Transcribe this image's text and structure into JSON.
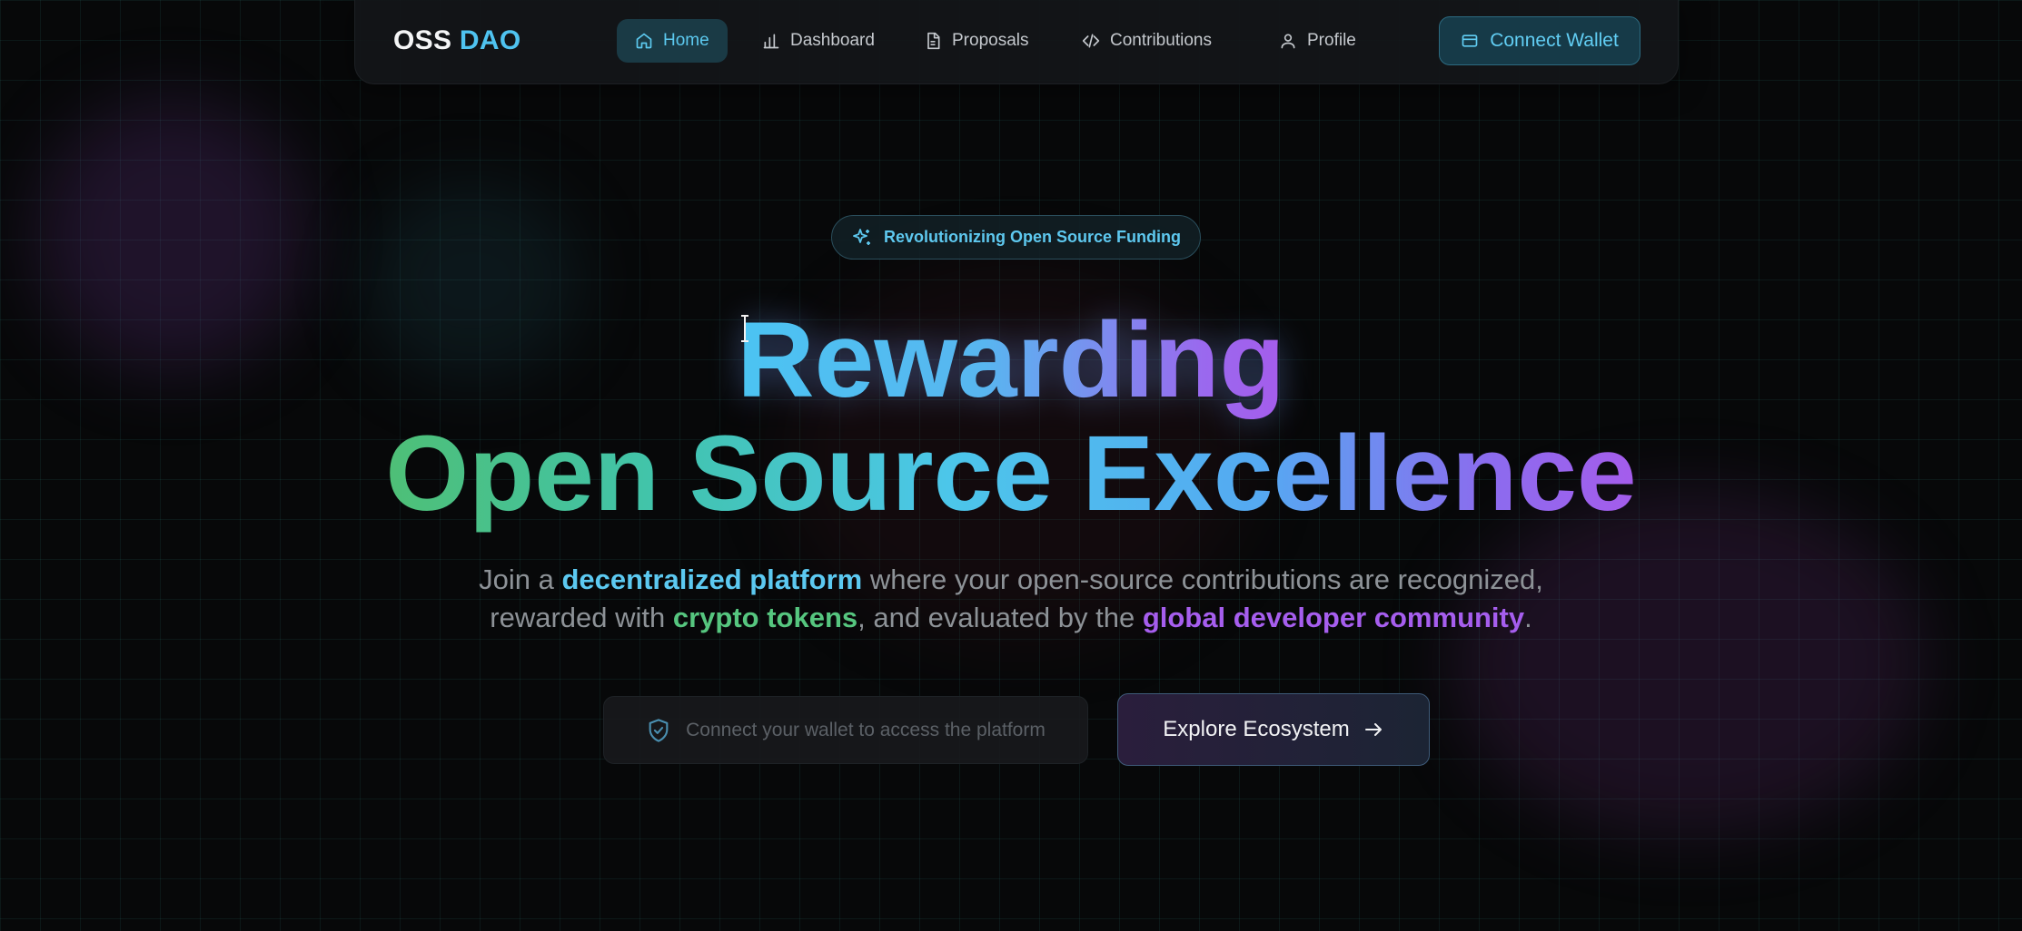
{
  "brand": {
    "part1": "OSS",
    "part2": "DAO"
  },
  "nav": {
    "items": [
      {
        "label": "Home",
        "icon": "home-icon",
        "active": true
      },
      {
        "label": "Dashboard",
        "icon": "bar-chart-icon",
        "active": false
      },
      {
        "label": "Proposals",
        "icon": "document-icon",
        "active": false
      },
      {
        "label": "Contributions",
        "icon": "code-icon",
        "active": false
      },
      {
        "label": "Profile",
        "icon": "user-icon",
        "active": false
      }
    ],
    "connect_label": "Connect Wallet"
  },
  "hero": {
    "badge": "Revolutionizing Open Source Funding",
    "title_line1": "Rewarding",
    "title_line2": "Open Source Excellence",
    "subtitle": {
      "p1": "Join a ",
      "h1": "decentralized platform",
      "p2": " where your open-source contributions are recognized,",
      "p3": "rewarded with ",
      "h2": "crypto tokens",
      "p4": ", and evaluated by the ",
      "h3": "global developer community",
      "p5": "."
    },
    "wallet_prompt": "Connect your wallet to access the platform",
    "explore_label": "Explore Ecosystem"
  },
  "colors": {
    "accent_cyan": "#4fc3f0",
    "accent_green": "#56c67f",
    "accent_purple": "#a65eee",
    "background": "#070809"
  }
}
